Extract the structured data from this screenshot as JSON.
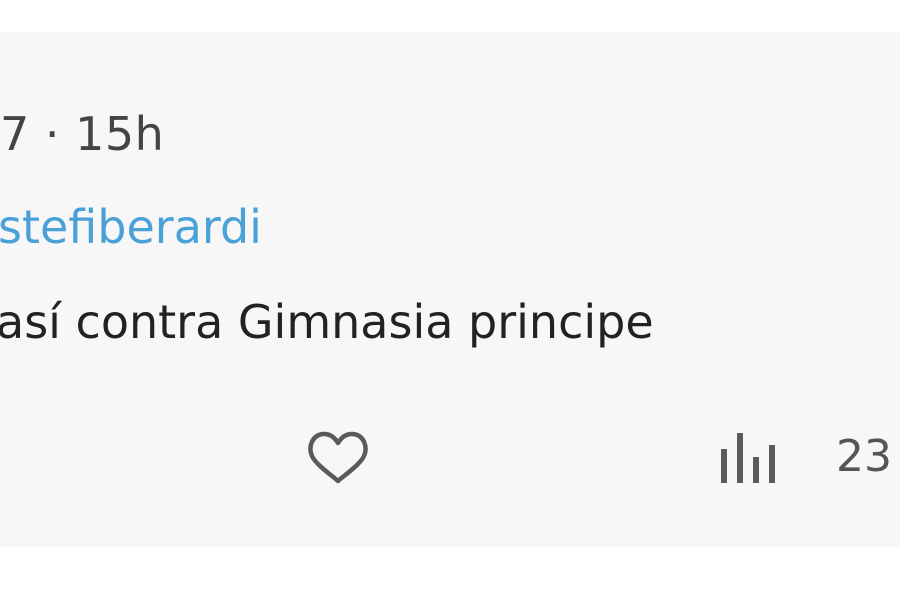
{
  "comment": {
    "meta_text": "7 · 15h",
    "mention": "stefiberardi",
    "body": "así contra Gimnasia principe",
    "actions": {
      "like_icon": "heart-outline-icon",
      "views_icon": "bar-chart-icon",
      "views_count": "23"
    }
  }
}
